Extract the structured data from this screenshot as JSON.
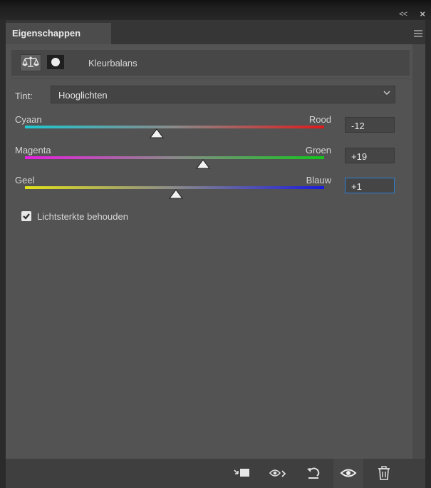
{
  "window": {
    "collapse_glyph": "<<",
    "close_glyph": "×"
  },
  "tabs": [
    {
      "label": "Eigenschappen",
      "active": true
    }
  ],
  "adjustment": {
    "title": "Kleurbalans",
    "icons": [
      "color-balance-icon",
      "mask-icon"
    ]
  },
  "tint": {
    "label": "Tint:",
    "value": "Hooglichten"
  },
  "sliders": [
    {
      "left": "Cyaan",
      "right": "Rood",
      "value": "-12",
      "level": -12,
      "min": -100,
      "max": 100,
      "gradient": [
        "#1ec8d2",
        "#e01b1b"
      ]
    },
    {
      "left": "Magenta",
      "right": "Groen",
      "value": "+19",
      "level": 19,
      "min": -100,
      "max": 100,
      "gradient": [
        "#e81ee0",
        "#12c61c"
      ]
    },
    {
      "left": "Geel",
      "right": "Blauw",
      "value": "+1",
      "level": 1,
      "min": -100,
      "max": 100,
      "gradient": [
        "#e2e21a",
        "#1a1ae0"
      ]
    }
  ],
  "checkbox": {
    "label": "Lichtsterkte behouden",
    "checked": true
  },
  "footer_icons": [
    "clip-to-layer-icon",
    "view-previous-state-icon",
    "reset-icon",
    "visibility-eye-icon",
    "trash-icon"
  ],
  "colors": {
    "panel": "#535353",
    "focus": "#2d7fd3"
  }
}
